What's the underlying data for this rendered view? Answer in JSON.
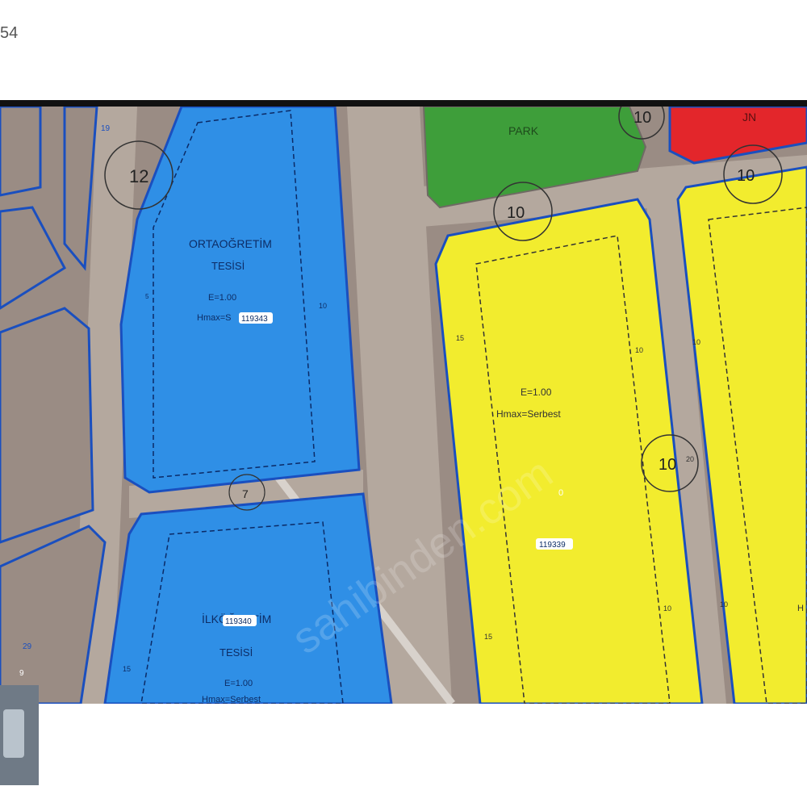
{
  "page": {
    "counter_text": "54"
  },
  "map": {
    "colors": {
      "terrain": "#9a8c84",
      "road": "#b4a89e",
      "school": "#2f8fe6",
      "park": "#3e9e3a",
      "residential": "#f2ec2e",
      "red_zone": "#e3262b",
      "outline": "#1a4fbf"
    },
    "parcels": {
      "secondary_school": {
        "name_line1": "ORTAOĞRETİM",
        "name_line2": "TESİSİ",
        "emsal": "E=1.00",
        "hmax": "Hmax=S",
        "parcel_id": "119343"
      },
      "primary_school": {
        "name_line1": "İLKÖĞRETİM",
        "name_line2": "TESİSİ",
        "emsal": "E=1.00",
        "hmax": "Hmax=Serbest",
        "parcel_id": "119340"
      },
      "park": {
        "name": "PARK"
      },
      "red_zone": {
        "name": "JN"
      },
      "residential_main": {
        "emsal": "E=1.00",
        "hmax": "Hmax=Serbest",
        "parcel_id": "119339",
        "marker": "0"
      },
      "residential_right": {
        "edge_text": "H"
      }
    },
    "road_widths": {
      "w12": "12",
      "w10_top": "10",
      "w10_middle": "10",
      "w10_right": "10",
      "w10_vertical": "10",
      "w7": "7"
    },
    "setbacks": {
      "s15": "15",
      "s10": "10",
      "s5": "5"
    },
    "small_labels": {
      "l19": "19",
      "l29": "29",
      "l9": "9",
      "l20": "20"
    },
    "watermark": "sahibinden.com"
  }
}
